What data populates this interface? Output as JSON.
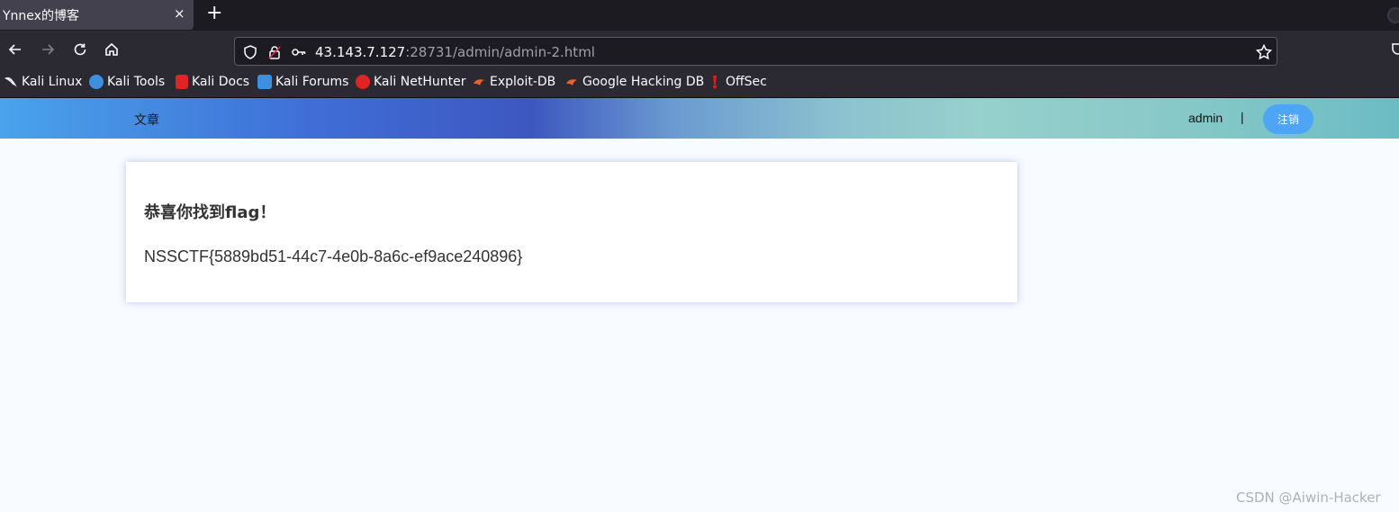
{
  "browser": {
    "tab": {
      "title": "Ynnex的博客",
      "close_glyph": "×"
    },
    "new_tab_glyph": "+",
    "url": {
      "host": "43.143.7.127",
      "path": ":28731/admin/admin-2.html"
    },
    "bookmarks": [
      {
        "label": "Kali Linux",
        "icon": "kali-dragon-icon",
        "color": "#ffffff"
      },
      {
        "label": "Kali Tools",
        "icon": "kali-tools-icon",
        "color": "#3d8fe0"
      },
      {
        "label": "Kali Docs",
        "icon": "kali-docs-icon",
        "color": "#e02424"
      },
      {
        "label": "Kali Forums",
        "icon": "kali-forums-icon",
        "color": "#3d8fe0"
      },
      {
        "label": "Kali NetHunter",
        "icon": "kali-nethunter-icon",
        "color": "#e02424"
      },
      {
        "label": "Exploit-DB",
        "icon": "exploit-db-icon",
        "color": "#e8622a"
      },
      {
        "label": "Google Hacking DB",
        "icon": "ghdb-icon",
        "color": "#e8622a"
      },
      {
        "label": "OffSec",
        "icon": "offsec-icon",
        "color": "#d42020"
      }
    ]
  },
  "header": {
    "nav_article": "文章",
    "user": "admin",
    "divider": "|",
    "logout_label": "注销",
    "accent": "#4ea4f5"
  },
  "card": {
    "title": "恭喜你找到flag！",
    "flag": "NSSCTF{5889bd51-44c7-4e0b-8a6c-ef9ace240896}"
  },
  "watermark": "CSDN @Aiwin-Hacker"
}
